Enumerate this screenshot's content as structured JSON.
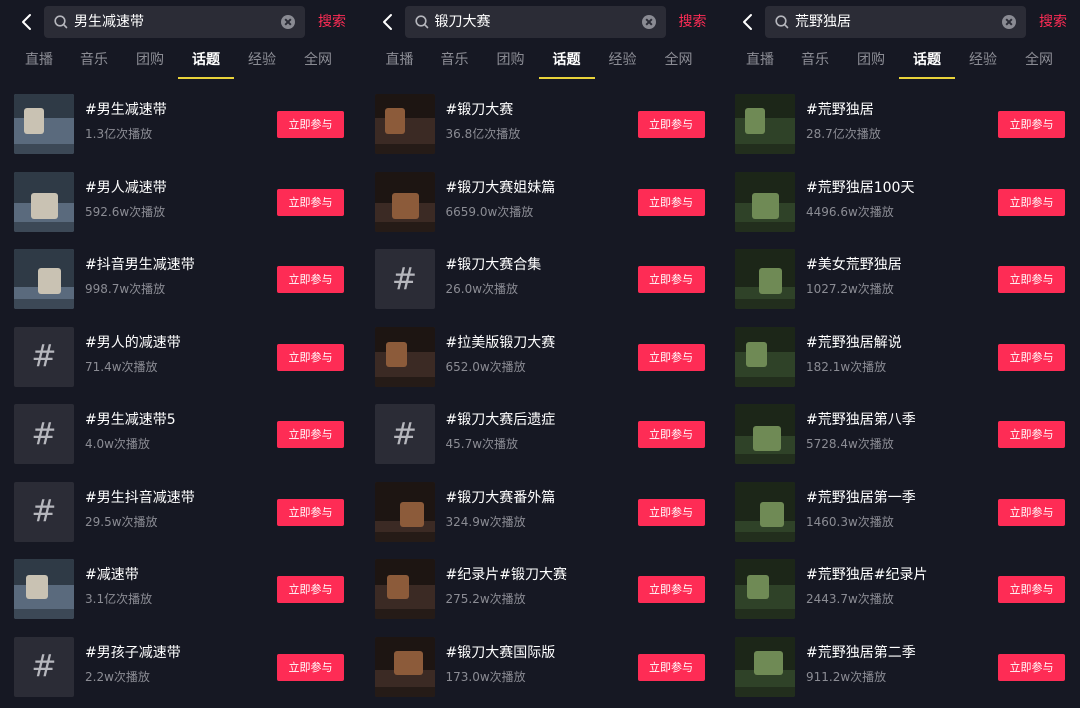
{
  "tabs": [
    "直播",
    "音乐",
    "团购",
    "话题",
    "经验",
    "全网"
  ],
  "active_tab_index": 3,
  "search_button_label": "搜索",
  "join_label": "立即参与",
  "colors": {
    "accent": "#fe2c55",
    "tab_underline": "#e9d33a",
    "background": "#161823"
  },
  "panels": [
    {
      "query": "男生减速带",
      "results": [
        {
          "title": "#男生减速带",
          "plays": "1.3亿次播放",
          "thumb": "image"
        },
        {
          "title": "#男人减速带",
          "plays": "592.6w次播放",
          "thumb": "image"
        },
        {
          "title": "#抖音男生减速带",
          "plays": "998.7w次播放",
          "thumb": "image"
        },
        {
          "title": "#男人的减速带",
          "plays": "71.4w次播放",
          "thumb": "hashtag"
        },
        {
          "title": "#男生减速带5",
          "plays": "4.0w次播放",
          "thumb": "hashtag"
        },
        {
          "title": "#男生抖音减速带",
          "plays": "29.5w次播放",
          "thumb": "hashtag"
        },
        {
          "title": "#减速带",
          "plays": "3.1亿次播放",
          "thumb": "image"
        },
        {
          "title": "#男孩子减速带",
          "plays": "2.2w次播放",
          "thumb": "hashtag"
        }
      ]
    },
    {
      "query": "锻刀大赛",
      "results": [
        {
          "title": "#锻刀大赛",
          "plays": "36.8亿次播放",
          "thumb": "image"
        },
        {
          "title": "#锻刀大赛姐妹篇",
          "plays": "6659.0w次播放",
          "thumb": "image"
        },
        {
          "title": "#锻刀大赛合集",
          "plays": "26.0w次播放",
          "thumb": "hashtag"
        },
        {
          "title": "#拉美版锻刀大赛",
          "plays": "652.0w次播放",
          "thumb": "image"
        },
        {
          "title": "#锻刀大赛后遗症",
          "plays": "45.7w次播放",
          "thumb": "hashtag"
        },
        {
          "title": "#锻刀大赛番外篇",
          "plays": "324.9w次播放",
          "thumb": "image"
        },
        {
          "title": "#纪录片#锻刀大赛",
          "plays": "275.2w次播放",
          "thumb": "image"
        },
        {
          "title": "#锻刀大赛国际版",
          "plays": "173.0w次播放",
          "thumb": "image"
        }
      ]
    },
    {
      "query": "荒野独居",
      "results": [
        {
          "title": "#荒野独居",
          "plays": "28.7亿次播放",
          "thumb": "image"
        },
        {
          "title": "#荒野独居100天",
          "plays": "4496.6w次播放",
          "thumb": "image"
        },
        {
          "title": "#美女荒野独居",
          "plays": "1027.2w次播放",
          "thumb": "image"
        },
        {
          "title": "#荒野独居解说",
          "plays": "182.1w次播放",
          "thumb": "image"
        },
        {
          "title": "#荒野独居第八季",
          "plays": "5728.4w次播放",
          "thumb": "image"
        },
        {
          "title": "#荒野独居第一季",
          "plays": "1460.3w次播放",
          "thumb": "image"
        },
        {
          "title": "#荒野独居#纪录片",
          "plays": "2443.7w次播放",
          "thumb": "image"
        },
        {
          "title": "#荒野独居第二季",
          "plays": "911.2w次播放",
          "thumb": "image"
        }
      ]
    }
  ]
}
